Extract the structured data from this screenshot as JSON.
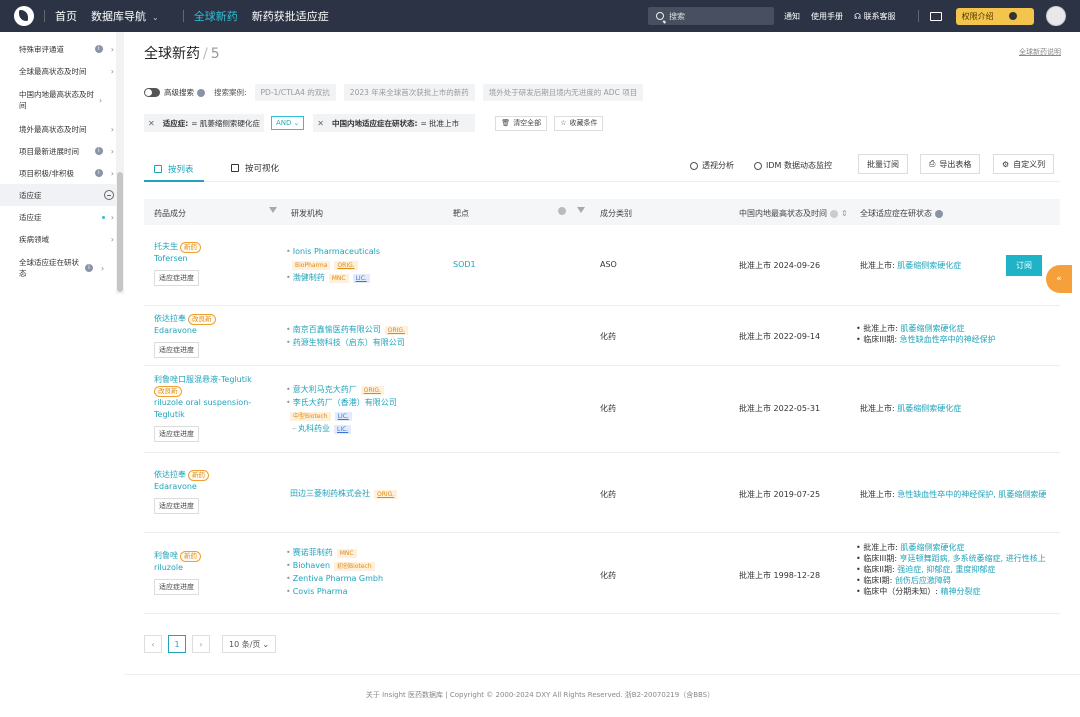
{
  "topbar": {
    "nav": [
      "首页",
      "数据库导航",
      "全球新药",
      "新药获批适应症"
    ],
    "search_placeholder": "搜索",
    "right": [
      "通知",
      "使用手册",
      "联系客服"
    ],
    "permission": "权限介绍"
  },
  "sidebar": {
    "items": [
      {
        "label": "特殊审评通道"
      },
      {
        "label": "全球最高状态及时间"
      },
      {
        "label": "中国内地最高状态及时间"
      },
      {
        "label": "境外最高状态及时间"
      },
      {
        "label": "项目最新进展时间"
      },
      {
        "label": "项目积极/非积极"
      },
      {
        "label": "适应症"
      },
      {
        "label": "适应症"
      },
      {
        "label": "疾病领域"
      },
      {
        "label": "全球适应症在研状态"
      }
    ]
  },
  "page": {
    "title": "全球新药",
    "count": "5",
    "desc_link": "全球新药说明"
  },
  "advanced": {
    "label": "高级搜索",
    "examples_label": "搜索案例:",
    "examples": [
      "PD-1/CTLA4 的双抗",
      "2023 年来全球首次获批上市的新药",
      "境外处于研发后期且境内无进度的 ADC 项目"
    ]
  },
  "filters": {
    "f1_key": "适应症:",
    "f1_val": "= 肌萎缩侧索硬化症",
    "op": "AND",
    "f2_key": "中国内地适应症在研状态:",
    "f2_val": "= 批准上市",
    "clear": "清空全部",
    "save": "收藏条件"
  },
  "tabs": {
    "list": "按列表",
    "visual": "按可视化",
    "pivot": "透视分析",
    "idm": "IDM 数据动态监控",
    "batch": "批量订阅",
    "export": "导出表格",
    "custom": "自定义列"
  },
  "table": {
    "headers": [
      "药品成分",
      "研发机构",
      "靶点",
      "成分类别",
      "中国内地最高状态及时间",
      "全球适应症在研状态"
    ],
    "progress_label": "适应症进度",
    "subscribe": "订阅",
    "rows": [
      {
        "name": "托夫生",
        "tag": "新药",
        "en": "Tofersen",
        "orgs": [
          {
            "name": "Ionis Pharmaceuticals",
            "tags": [
              {
                "t": "BioPharma",
                "c": "o"
              },
              {
                "t": "ORIG.",
                "c": "ou"
              }
            ]
          },
          {
            "name": "渤健制药",
            "tags": [
              {
                "t": "MNC",
                "c": "o"
              },
              {
                "t": "LIC.",
                "c": "b"
              }
            ]
          }
        ],
        "target": "SOD1",
        "category": "ASO",
        "status": "批准上市 2024-09-26",
        "global": [
          {
            "k": "批准上市:",
            "v": "肌萎缩侧索硬化症"
          }
        ]
      },
      {
        "name": "依达拉奉",
        "tag": "改良新",
        "en": "Edaravone",
        "orgs": [
          {
            "name": "南京百鑫愉医药有限公司",
            "tags": [
              {
                "t": "ORIG.",
                "c": "ou"
              }
            ]
          },
          {
            "name": "药源生物科技（启东）有限公司",
            "tags": []
          }
        ],
        "target": "",
        "category": "化药",
        "status": "批准上市 2022-09-14",
        "global": [
          {
            "k": "批准上市:",
            "v": "肌萎缩侧索硬化症"
          },
          {
            "k": "临床III期:",
            "v": "急性缺血性卒中的神经保护"
          }
        ]
      },
      {
        "name": "利鲁唑口服混悬液-Teglutik",
        "tag": "改良新",
        "en": "riluzole oral suspension-Teglutik",
        "orgs": [
          {
            "name": "意大利马克大药厂",
            "tags": [
              {
                "t": "ORIG.",
                "c": "ou"
              }
            ]
          },
          {
            "name": "李氏大药厂（香港）有限公司",
            "tags": []
          },
          {
            "name": "",
            "tags": [
              {
                "t": "中型Biotech",
                "c": "o"
              },
              {
                "t": "LIC.",
                "c": "b"
              }
            ]
          },
          {
            "name": "丸科药业",
            "tags": [
              {
                "t": "LIC.",
                "c": "b"
              }
            ]
          }
        ],
        "target": "",
        "category": "化药",
        "status": "批准上市 2022-05-31",
        "global": [
          {
            "k": "批准上市:",
            "v": "肌萎缩侧索硬化症"
          }
        ]
      },
      {
        "name": "依达拉奉",
        "tag": "新药",
        "en": "Edaravone",
        "orgs": [
          {
            "name": "田边三菱制药株式会社",
            "tags": [
              {
                "t": "ORIG.",
                "c": "ou"
              }
            ]
          }
        ],
        "target": "",
        "category": "化药",
        "status": "批准上市 2019-07-25",
        "global": [
          {
            "k": "批准上市:",
            "v": "急性缺血性卒中的神经保护, 肌萎缩侧索硬"
          }
        ]
      },
      {
        "name": "利鲁唑",
        "tag": "新药",
        "en": "riluzole",
        "orgs": [
          {
            "name": "赛诺菲制药",
            "tags": [
              {
                "t": "MNC",
                "c": "o"
              }
            ]
          },
          {
            "name": "Biohaven",
            "tags": [
              {
                "t": "初创Biotech",
                "c": "o"
              }
            ]
          },
          {
            "name": "Zentiva Pharma Gmbh",
            "tags": []
          },
          {
            "name": "Covis Pharma",
            "tags": []
          }
        ],
        "target": "",
        "category": "化药",
        "status": "批准上市 1998-12-28",
        "global": [
          {
            "k": "批准上市:",
            "v": "肌萎缩侧索硬化症"
          },
          {
            "k": "临床III期:",
            "v": "亨廷顿舞蹈病, 多系统萎缩症, 进行性核上"
          },
          {
            "k": "临床II期:",
            "v": "强迫症, 抑郁症, 重度抑郁症"
          },
          {
            "k": "临床I期:",
            "v": "创伤后应激障碍"
          },
          {
            "k": "临床中（分期未知）:",
            "v": "精神分裂症"
          }
        ]
      }
    ]
  },
  "pager": {
    "current": "1",
    "size": "10 条/页"
  },
  "footer": "关于 Insight 医药数据库 | Copyright © 2000-2024 DXY All Rights Reserved. 浙B2-20070219（含BBS）"
}
